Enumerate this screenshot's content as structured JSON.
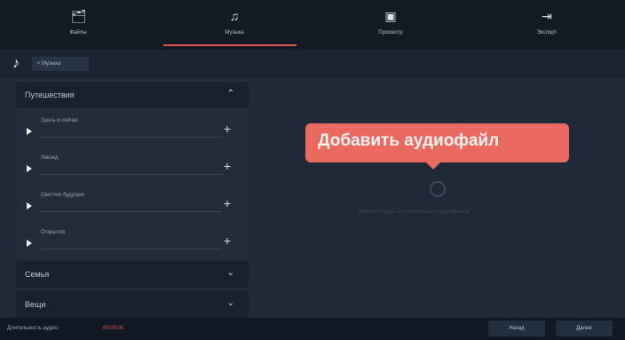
{
  "tabs": [
    {
      "label": "Файлы",
      "icon": "files-icon"
    },
    {
      "label": "Музыка",
      "icon": "music-icon"
    },
    {
      "label": "Просмотр",
      "icon": "preview-icon"
    },
    {
      "label": "Экспорт",
      "icon": "export-icon"
    }
  ],
  "active_tab": "Музыка",
  "breadcrumb": {
    "label": "< Музыка"
  },
  "sidebar": {
    "sections": [
      {
        "title": "Путешествия",
        "toggle": "up",
        "expanded": true,
        "tracks": [
          {
            "name": "Здесь и сейчас"
          },
          {
            "name": "Уикэнд"
          },
          {
            "name": "Светлое будущее"
          },
          {
            "name": "Открытия"
          }
        ]
      },
      {
        "title": "Семья",
        "toggle": "down",
        "expanded": false,
        "tracks": []
      },
      {
        "title": "Вещи",
        "toggle": "down",
        "expanded": false,
        "tracks": []
      }
    ]
  },
  "main": {
    "tooltip": "Добавить аудиофайл",
    "hint": "Нажмите сюда или перетащите аудиофайлы"
  },
  "bottom": {
    "duration_label": "Длительность аудио:",
    "duration_value": "00:00:00",
    "back_button": "Назад",
    "next_button": "Далее"
  },
  "colors": {
    "accent": "#e2564f",
    "tooltip": "#ea6a62"
  }
}
